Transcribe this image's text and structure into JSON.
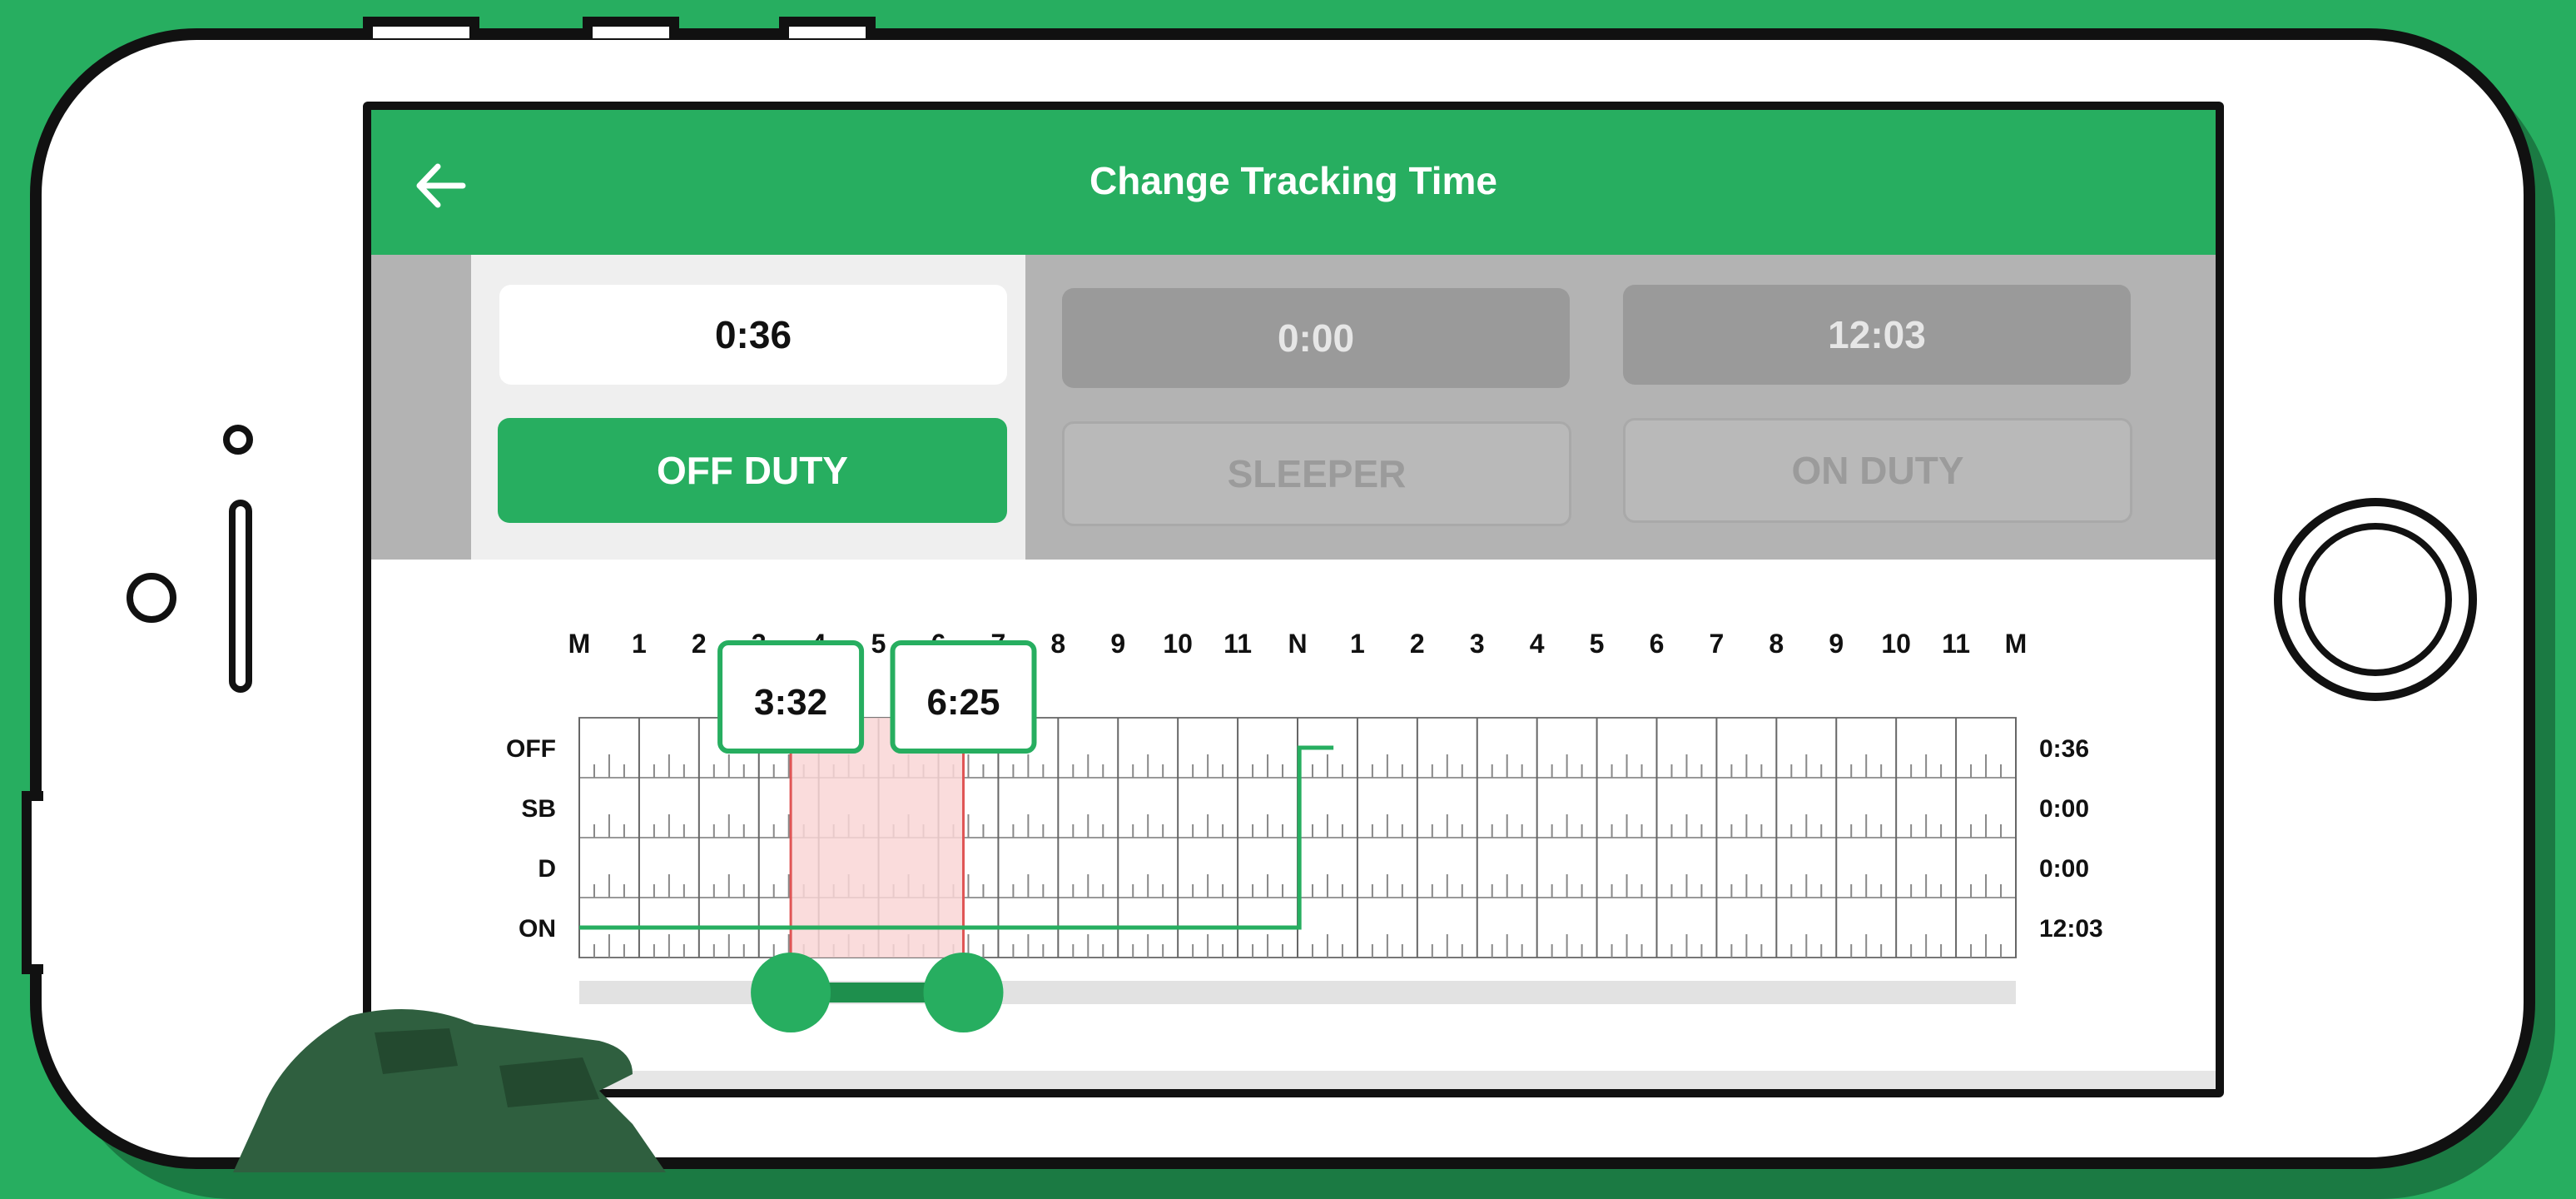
{
  "app_bar": {
    "title": "Change Tracking Time",
    "back_icon": "arrow-left-icon"
  },
  "status_panel": {
    "columns": [
      {
        "time": "0:36",
        "label": "OFF DUTY",
        "active": true
      },
      {
        "time": "0:00",
        "label": "SLEEPER",
        "active": false
      },
      {
        "time": "12:03",
        "label": "ON DUTY",
        "active": false
      }
    ]
  },
  "log_graph": {
    "hour_labels": [
      "M",
      "1",
      "2",
      "3",
      "4",
      "5",
      "6",
      "7",
      "8",
      "9",
      "10",
      "11",
      "N",
      "1",
      "2",
      "3",
      "4",
      "5",
      "6",
      "7",
      "8",
      "9",
      "10",
      "11",
      "M"
    ],
    "rows": [
      {
        "label": "OFF",
        "total": "0:36"
      },
      {
        "label": "SB",
        "total": "0:00"
      },
      {
        "label": "D",
        "total": "0:00"
      },
      {
        "label": "ON",
        "total": "12:03"
      }
    ],
    "duty_segments": [
      {
        "status": "ON",
        "start_hour": 0,
        "end_hour": 12.03
      },
      {
        "status": "OFF",
        "start_hour": 12.03,
        "end_hour": 12.6
      }
    ],
    "selection": {
      "start_label": "3:32",
      "end_label": "6:25",
      "start_hour": 3.533,
      "end_hour": 6.417
    }
  },
  "colors": {
    "brand_green": "#27ae60",
    "selection_red": "#e05555",
    "selection_fill": "#f9d6d6",
    "inactive_gray": "#b3b3b3"
  }
}
